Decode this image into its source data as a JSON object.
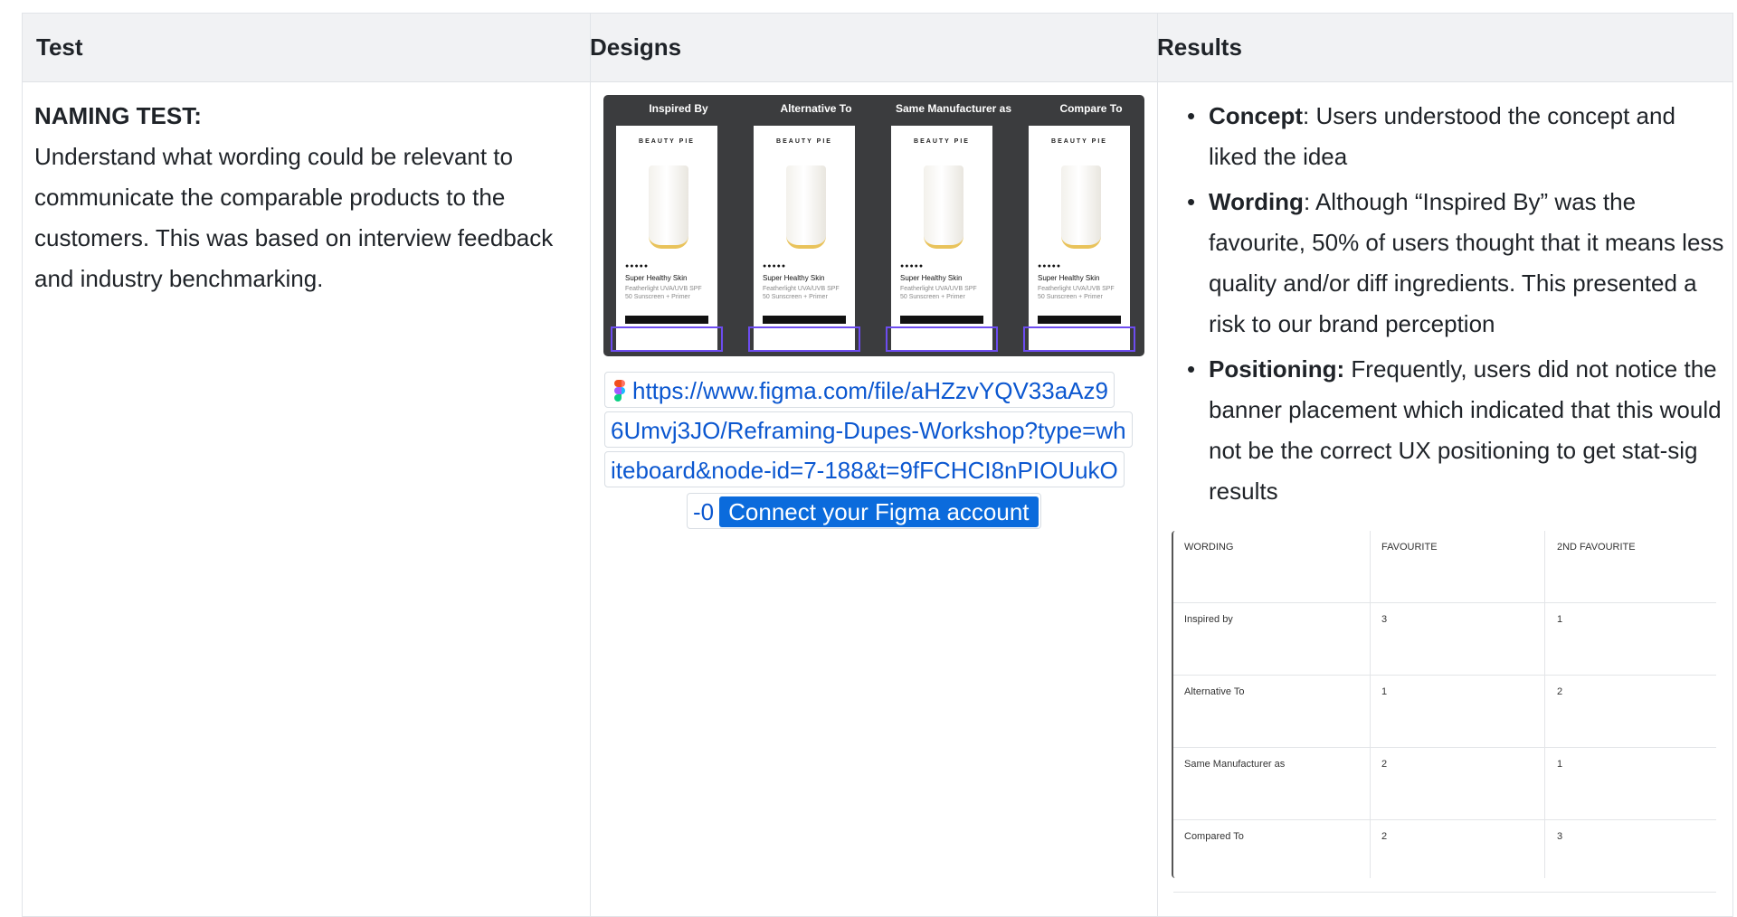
{
  "headers": {
    "test": "Test",
    "designs": "Designs",
    "results": "Results"
  },
  "test": {
    "title": "NAMING TEST:",
    "body": "Understand what wording could be relevant to communicate the comparable products to the customers. This was based on interview feedback and industry benchmarking."
  },
  "designs": {
    "phones": [
      {
        "label": "Inspired By",
        "brand": "BEAUTY PIE",
        "name": "Super Healthy Skin",
        "desc": "Featherlight UVA/UVB SPF 50 Sunscreen + Primer",
        "stars": "●●●●●"
      },
      {
        "label": "Alternative To",
        "brand": "BEAUTY PIE",
        "name": "Super Healthy Skin",
        "desc": "Featherlight UVA/UVB SPF 50 Sunscreen + Primer",
        "stars": "●●●●●"
      },
      {
        "label": "Same Manufacturer as",
        "brand": "BEAUTY PIE",
        "name": "Super Healthy Skin",
        "desc": "Featherlight UVA/UVB SPF 50 Sunscreen + Primer",
        "stars": "●●●●●"
      },
      {
        "label": "Compare To",
        "brand": "BEAUTY PIE",
        "name": "Super Healthy Skin",
        "desc": "Featherlight UVA/UVB SPF 50 Sunscreen + Primer",
        "stars": "●●●●●"
      }
    ],
    "link_lines": [
      "https://www.figma.com/file/aHZzvYQV33aAz9",
      "6Umvj3JO/Reframing-Dupes-Workshop?type=wh",
      "iteboard&node-id=7-188&t=9fFCHCI8nPIOUukO",
      "-0"
    ],
    "connect_label": "Connect your Figma account"
  },
  "results": {
    "items": [
      {
        "label": "Concept",
        "text": ": Users understood the concept and liked the idea"
      },
      {
        "label": "Wording",
        "text": ": Although “Inspired By” was the favourite, 50% of users thought that it means less quality and/or diff ingredients. This presented a risk to our brand perception"
      },
      {
        "label": "Positioning:",
        "text": " Frequently, users did not notice the banner placement which indicated that this would not be the correct UX positioning to get stat-sig results"
      }
    ],
    "table": {
      "headers": [
        "WORDING",
        "FAVOURITE",
        "2ND FAVOURITE"
      ],
      "rows": [
        [
          "Inspired by",
          "3",
          "1"
        ],
        [
          "Alternative To",
          "1",
          "2"
        ],
        [
          "Same Manufacturer as",
          "2",
          "1"
        ],
        [
          "Compared To",
          "2",
          "3"
        ]
      ]
    }
  }
}
